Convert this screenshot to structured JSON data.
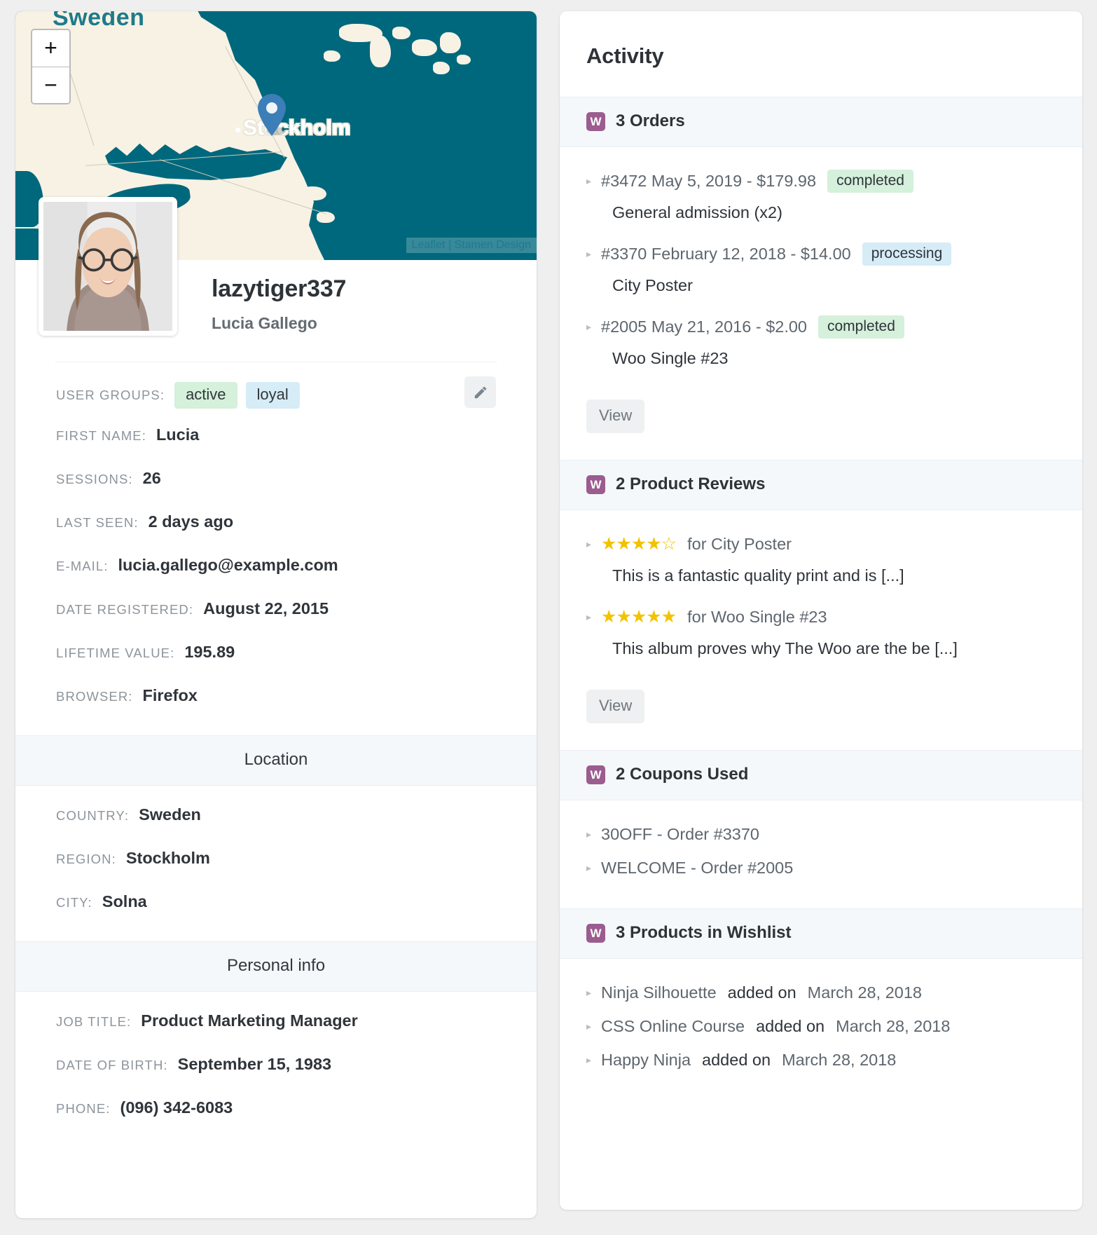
{
  "map": {
    "country_label": "Sweden",
    "city_label": "Stockholm",
    "zoom_in": "+",
    "zoom_out": "−",
    "attribution": "Leaflet | Stamen Design",
    "pin_color": "#3c7eb8",
    "sea_color": "#00687d",
    "land_color": "#f7f2e4"
  },
  "profile": {
    "username": "lazytiger337",
    "full_name": "Lucia Gallego",
    "edit_icon": "pencil-icon",
    "attributes": [
      {
        "label": "USER GROUPS:",
        "type": "chips",
        "chips": [
          {
            "text": "active",
            "color": "#d5f0db"
          },
          {
            "text": "loyal",
            "color": "#d6ecf6"
          }
        ]
      },
      {
        "label": "FIRST NAME:",
        "value": "Lucia"
      },
      {
        "label": "SESSIONS:",
        "value": "26"
      },
      {
        "label": "LAST SEEN:",
        "value": "2 days ago"
      },
      {
        "label": "E-MAIL:",
        "value": "lucia.gallego@example.com"
      },
      {
        "label": "DATE REGISTERED:",
        "value": "August 22, 2015"
      },
      {
        "label": "LIFETIME VALUE:",
        "value": "195.89"
      },
      {
        "label": "BROWSER:",
        "value": "Firefox"
      }
    ],
    "location": {
      "heading": "Location",
      "attributes": [
        {
          "label": "COUNTRY:",
          "value": "Sweden"
        },
        {
          "label": "REGION:",
          "value": "Stockholm"
        },
        {
          "label": "CITY:",
          "value": "Solna"
        }
      ]
    },
    "personal": {
      "heading": "Personal info",
      "attributes": [
        {
          "label": "JOB TITLE:",
          "value": "Product Marketing Manager"
        },
        {
          "label": "DATE OF BIRTH:",
          "value": "September 15, 1983"
        },
        {
          "label": "PHONE:",
          "value": "(096) 342-6083"
        }
      ]
    }
  },
  "activity": {
    "title": "Activity",
    "badge_letter": "W",
    "badge_color": "#9b5c8f",
    "orders": {
      "heading": "3 Orders",
      "items": [
        {
          "main": "#3472 May 5, 2019 - $179.98",
          "status": "completed",
          "status_type": "completed",
          "sub": "General admission (x2)"
        },
        {
          "main": "#3370 February 12, 2018 - $14.00",
          "status": "processing",
          "status_type": "processing",
          "sub": "City Poster"
        },
        {
          "main": "#2005 May 21, 2016 - $2.00",
          "status": "completed",
          "status_type": "completed",
          "sub": "Woo Single #23"
        }
      ],
      "view_label": "View"
    },
    "reviews": {
      "heading": "2 Product Reviews",
      "items": [
        {
          "stars": "★★★★☆",
          "for": "for City Poster",
          "sub": "This is a fantastic quality print and is [...]"
        },
        {
          "stars": "★★★★★",
          "for": "for Woo Single #23",
          "sub": "This album proves why The Woo are the be [...]"
        }
      ],
      "view_label": "View"
    },
    "coupons": {
      "heading": "2 Coupons Used",
      "items": [
        {
          "main": "30OFF - Order #3370"
        },
        {
          "main": "WELCOME - Order #2005"
        }
      ]
    },
    "wishlist": {
      "heading": "3 Products in Wishlist",
      "items": [
        {
          "name": "Ninja Silhouette",
          "added": "added on",
          "date": "March 28, 2018"
        },
        {
          "name": "CSS Online Course",
          "added": "added on",
          "date": "March 28, 2018"
        },
        {
          "name": "Happy Ninja",
          "added": "added on",
          "date": "March 28, 2018"
        }
      ]
    }
  }
}
